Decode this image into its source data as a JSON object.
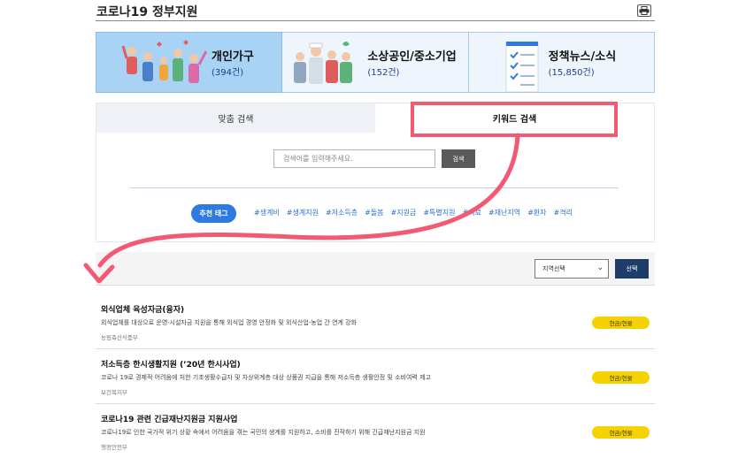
{
  "header": {
    "title": "코로나19 정부지원",
    "print_icon": "printer-icon"
  },
  "categories": [
    {
      "label": "개인가구",
      "count": "(394건)",
      "icon": "people-group-illustration"
    },
    {
      "label": "소상공인/중소기업",
      "count": "(152건)",
      "icon": "workers-illustration"
    },
    {
      "label": "정책뉴스/소식",
      "count": "(15,850건)",
      "icon": "checklist-illustration"
    }
  ],
  "search": {
    "tabs": [
      "맞춤 검색",
      "키워드 검색"
    ],
    "active_tab": 1,
    "placeholder": "검색어를 입력해주세요.",
    "button": "검색",
    "tag_label": "추천 태그",
    "tags": [
      "#생계비",
      "#생계지원",
      "#저소득층",
      "#돌봄",
      "#지원금",
      "#특별지원",
      "#의료",
      "#재난지역",
      "#환자",
      "#격리"
    ]
  },
  "filter": {
    "region_value": "지역선택",
    "select_button": "선택"
  },
  "items": [
    {
      "title": "외식업체 육성자금(융자)",
      "desc": "외식업체를 대상으로 운영·시설자금 지원을 통해 외식업 경영 안정화 및 외식산업-농업 간 연계 강화",
      "org": "농림축산식품부",
      "badge": "현금/현물"
    },
    {
      "title": "저소득층 한시생활지원 (’20년 한시사업)",
      "desc": "코로나 19로 경제적 어려움에 처한 기초생활수급자 및 차상위계층 대상 상품권 지급을 통해 저소득층 생활안정 및 소비여력 제고",
      "org": "보건복지부",
      "badge": "현금/현물"
    },
    {
      "title": "코로나19 관련 긴급재난지원금 지원사업",
      "desc": "코로나19로 인한 국가적 위기 상황 속에서 어려움을 겪는 국민의 생계를 지원하고, 소비를 진작하기 위해 긴급재난지원금 지원",
      "org": "행정안전부",
      "badge": "현금/현물"
    }
  ],
  "colors": {
    "highlight": "#f25a73",
    "accent_blue": "#2e7ae0",
    "badge": "#f5d200",
    "dark_button": "#1f3d6b"
  }
}
